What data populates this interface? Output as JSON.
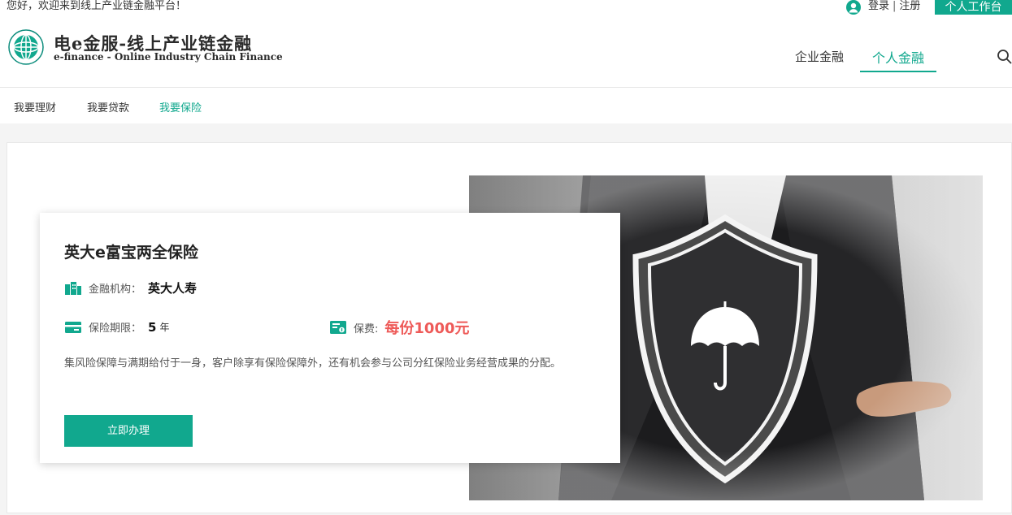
{
  "topbar": {
    "welcome": "您好，欢迎来到线上产业链金融平台！",
    "login": "登录",
    "separator": "|",
    "register": "注册",
    "workbench": "个人工作台"
  },
  "header": {
    "title": "电e金服-线上产业链金融",
    "subtitle": "e-finance - Online Industry Chain Finance",
    "nav": [
      "企业金融",
      "个人金融"
    ],
    "active_nav": "个人金融"
  },
  "subnav": {
    "items": [
      "我要理财",
      "我要贷款",
      "我要保险"
    ],
    "active": "我要保险"
  },
  "product": {
    "title": "英大e富宝两全保险",
    "institution_label": "金融机构：",
    "institution": "英大人寿",
    "term_label": "保险期限：",
    "term_value": "5",
    "term_unit": "年",
    "premium_label": "保费:",
    "premium": "每份1000元",
    "description": "集风险保障与满期给付于一身，客户除享有保险保障外，还有机会参与公司分红保险业务经营成果的分配。",
    "button": "立即办理"
  },
  "colors": {
    "accent": "#11a88e",
    "price": "#ee5a58"
  }
}
